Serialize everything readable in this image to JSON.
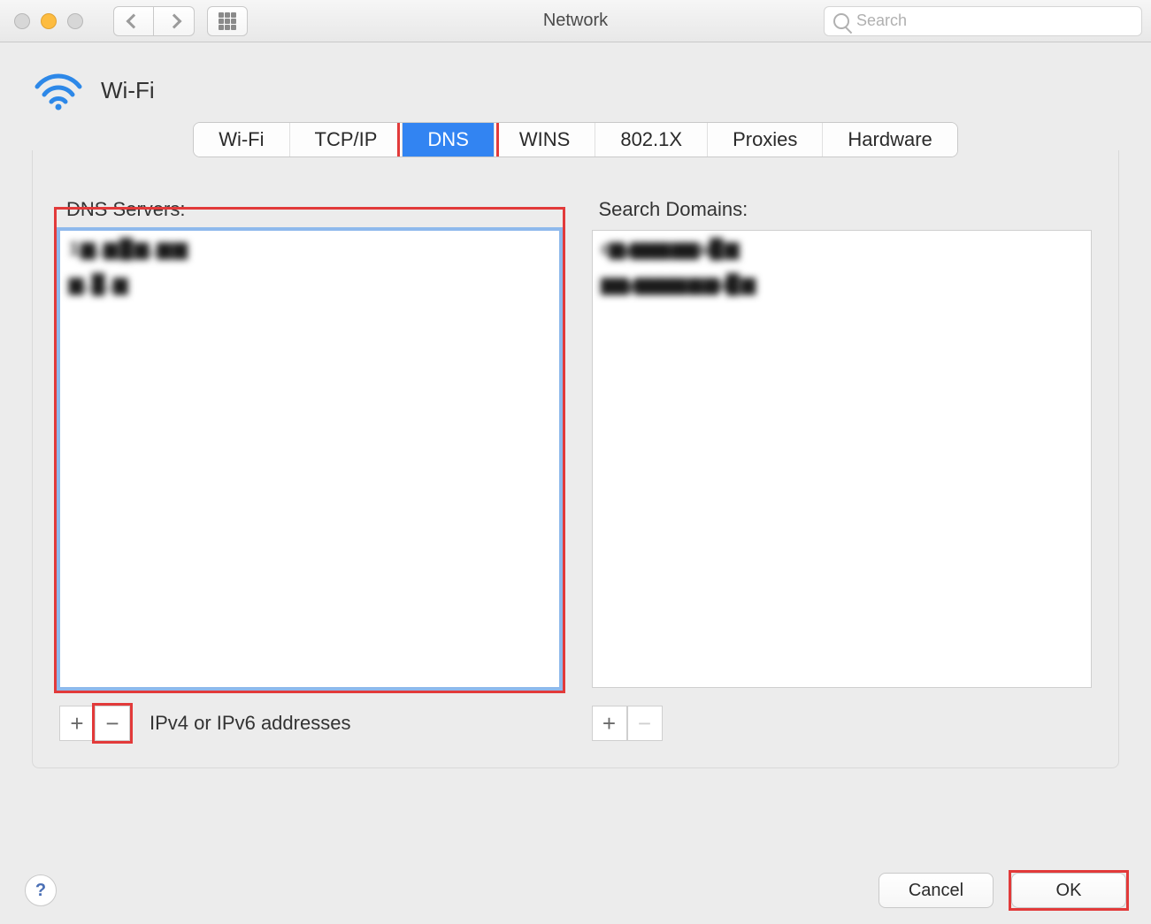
{
  "window": {
    "title": "Network"
  },
  "search": {
    "placeholder": "Search"
  },
  "header": {
    "interface_label": "Wi-Fi"
  },
  "tabs": [
    {
      "label": "Wi-Fi",
      "active": false
    },
    {
      "label": "TCP/IP",
      "active": false
    },
    {
      "label": "DNS",
      "active": true
    },
    {
      "label": "WINS",
      "active": false
    },
    {
      "label": "802.1X",
      "active": false
    },
    {
      "label": "Proxies",
      "active": false
    },
    {
      "label": "Hardware",
      "active": false
    }
  ],
  "dns_servers": {
    "header": "DNS Servers:",
    "rows": [
      "1 ▆ . ▆ █ ▆ . ▆ ▆",
      "▆ . █ . ▆"
    ],
    "footer_label": "IPv4 or IPv6 addresses"
  },
  "search_domains": {
    "header": "Search Domains:",
    "rows": [
      "c▆y▆▆▆.▆▆.u█ ▆",
      "▆▆y▆▆▆▆.▆.▆u█ ▆"
    ]
  },
  "buttons": {
    "cancel": "Cancel",
    "ok": "OK",
    "help": "?"
  }
}
